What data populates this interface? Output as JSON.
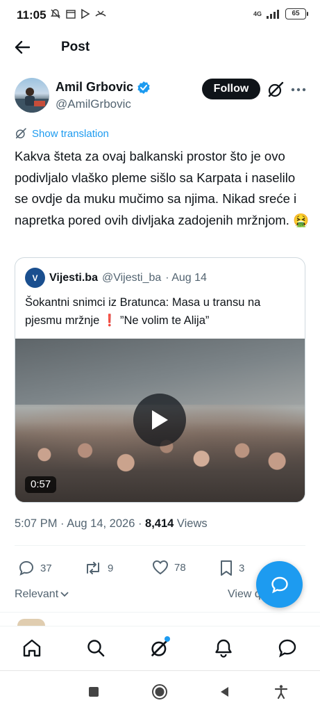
{
  "status_bar": {
    "time": "11:05",
    "network": "4G",
    "battery": "65"
  },
  "header": {
    "title": "Post"
  },
  "author": {
    "name": "Amil Grbovic",
    "handle": "@AmilGrbovic",
    "follow_label": "Follow"
  },
  "translation": {
    "label": "Show translation"
  },
  "tweet": {
    "text": "Kakva šteta za ovaj balkanski prostor što je ovo podivljalo vlaško pleme sišlo sa Karpata i naselilo se ovdje da muku mučimo sa njima. Nikad sreće i napretka pored ovih divljaka zadojenih mržnjom. 🤮"
  },
  "quote": {
    "name": "Vijesti.ba",
    "handle": "@Vijesti_ba",
    "date": "· Aug 14",
    "text": "Šokantni snimci iz Bratunca: Masa u transu na pjesmu mržnje ❗ ”Ne volim te Alija”",
    "avatar_text": "V",
    "video_duration": "0:57"
  },
  "meta": {
    "time": "5:07 PM · Aug 14, 2026 · ",
    "views_count": "8,414",
    "views_label": " Views"
  },
  "actions": {
    "replies": "37",
    "reposts": "9",
    "likes": "78",
    "bookmarks": "3"
  },
  "sort": {
    "relevant_label": "Relevant",
    "view_label": "View q"
  },
  "icons": {
    "back": "arrow-left-icon",
    "verified": "verified-badge-icon",
    "grok": "grok-icon",
    "more": "more-icon",
    "reply": "reply-icon",
    "repost": "repost-icon",
    "like": "heart-icon",
    "bookmark": "bookmark-icon",
    "fab": "compose-reply-icon",
    "nav": [
      "home-icon",
      "search-icon",
      "grok-icon",
      "bell-icon",
      "messages-icon"
    ]
  },
  "colors": {
    "accent": "#1d9bf0",
    "text": "#0f1419",
    "secondary": "#536471"
  }
}
